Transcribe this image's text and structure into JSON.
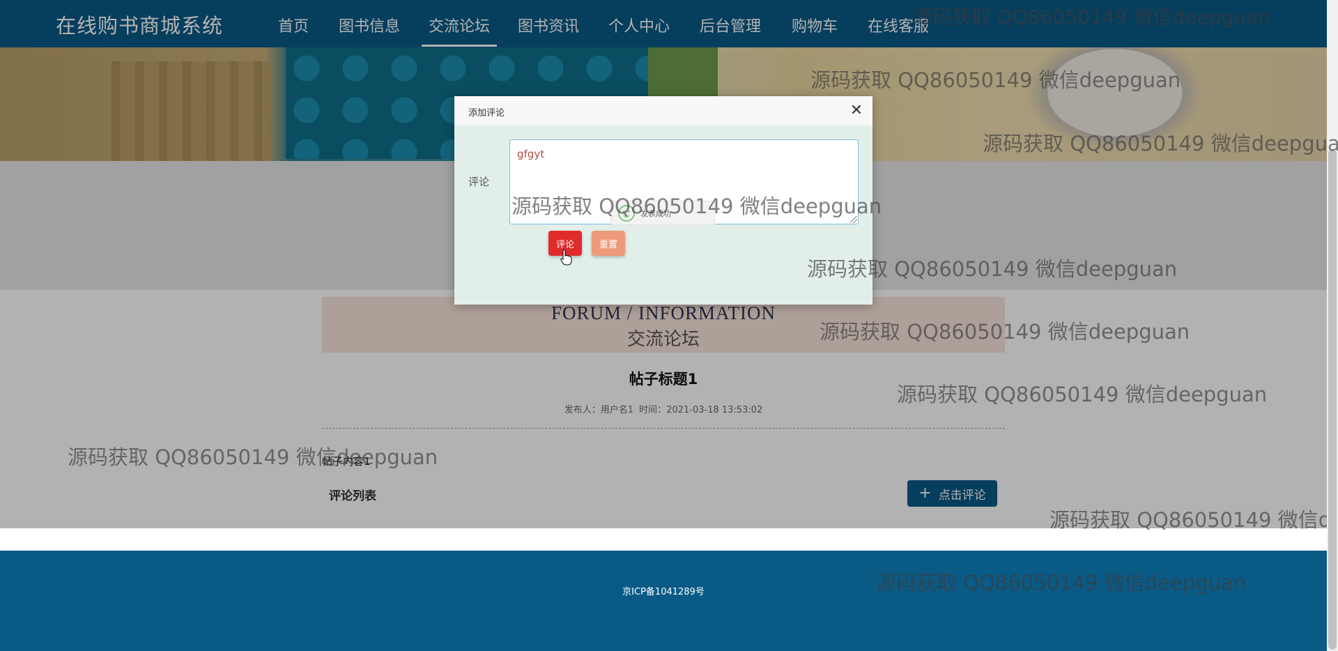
{
  "header": {
    "brand": "在线购书商城系统",
    "nav": [
      {
        "label": "首页"
      },
      {
        "label": "图书信息"
      },
      {
        "label": "交流论坛",
        "active": true
      },
      {
        "label": "图书资讯"
      },
      {
        "label": "个人中心"
      },
      {
        "label": "后台管理"
      },
      {
        "label": "购物车"
      },
      {
        "label": "在线客服"
      }
    ]
  },
  "forum": {
    "heading_en": "FORUM / INFORMATION",
    "heading_cn": "交流论坛",
    "post_title": "帖子标题1",
    "meta_publisher_label": "发布人：",
    "meta_publisher": "用户名1",
    "meta_time_label": "时间：",
    "meta_time": "2021-03-18 13:53:02",
    "post_content": "帖子内容1",
    "comments_heading": "评论列表",
    "comment_button": "点击评论",
    "comment_button_icon": "plus-icon"
  },
  "footer": {
    "icp": "京ICP备1041289号"
  },
  "dialog": {
    "title": "添加评论",
    "close_icon": "close-icon",
    "field_label": "评论",
    "comment_value": "gfgyt",
    "submit_label": "评论",
    "reset_label": "重置",
    "toast_text": "发表成功",
    "toast_icon": "smile-icon"
  },
  "watermark": {
    "text": "源码获取 QQ86050149 微信deepguan"
  },
  "colors": {
    "nav_bg": "#0a5a86",
    "submit": "#e02b2b",
    "reset": "#ee9a7a",
    "forum_head_bg": "#f8e6da"
  }
}
